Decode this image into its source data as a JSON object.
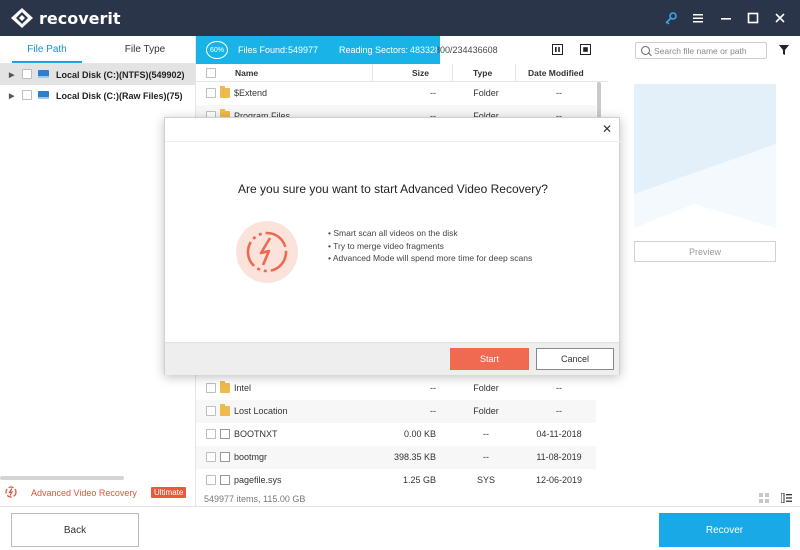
{
  "app": {
    "brand": "recoverit",
    "accent": "#1ab3e8",
    "titlebar_color": "#2b3549"
  },
  "titlebar_icons": [
    "key-icon",
    "menu-icon",
    "minimize-icon",
    "maximize-icon",
    "close-icon"
  ],
  "sidebar": {
    "tabs": [
      {
        "label": "File Path",
        "active": true
      },
      {
        "label": "File Type",
        "active": false
      }
    ],
    "tree": [
      {
        "label": "Local Disk (C:)(NTFS)(549902)",
        "selected": true
      },
      {
        "label": "Local Disk (C:)(Raw Files)(75)",
        "selected": false
      }
    ],
    "advanced": {
      "label": "Advanced Video Recovery",
      "badge": "Ultimate"
    }
  },
  "scan": {
    "percent": "60%",
    "files_found_label": "Files Found:",
    "files_found": "549977",
    "sectors_label": "Reading Sectors:",
    "sectors_value": "48332800/234436608"
  },
  "file_list": {
    "columns": [
      "Name",
      "Size",
      "Type",
      "Date Modified"
    ],
    "rows": [
      {
        "name": "$Extend",
        "size": "--",
        "type": "Folder",
        "date": "--",
        "kind": "folder"
      },
      {
        "name": "Program Files",
        "size": "--",
        "type": "Folder",
        "date": "--",
        "kind": "folder"
      },
      {
        "name": "Intel",
        "size": "--",
        "type": "Folder",
        "date": "--",
        "kind": "folder"
      },
      {
        "name": "Lost Location",
        "size": "--",
        "type": "Folder",
        "date": "--",
        "kind": "folder"
      },
      {
        "name": "BOOTNXT",
        "size": "0.00  KB",
        "type": "--",
        "date": "04-11-2018",
        "kind": "file"
      },
      {
        "name": "bootmgr",
        "size": "398.35  KB",
        "type": "--",
        "date": "11-08-2019",
        "kind": "file"
      },
      {
        "name": "pagefile.sys",
        "size": "1.25  GB",
        "type": "SYS",
        "date": "12-06-2019",
        "kind": "file"
      }
    ],
    "status": "549977 items, 115.00  GB"
  },
  "right_panel": {
    "search_placeholder": "Search file name or path",
    "preview_label": "Preview"
  },
  "bottom": {
    "back_label": "Back",
    "recover_label": "Recover"
  },
  "dialog": {
    "title": "Are you sure you want to start Advanced Video Recovery?",
    "bullets": [
      "• Smart scan all videos on the disk",
      "• Try to merge video fragments",
      "• Advanced Mode will spend more time for deep scans"
    ],
    "start_label": "Start",
    "cancel_label": "Cancel",
    "close_glyph": "✕"
  }
}
